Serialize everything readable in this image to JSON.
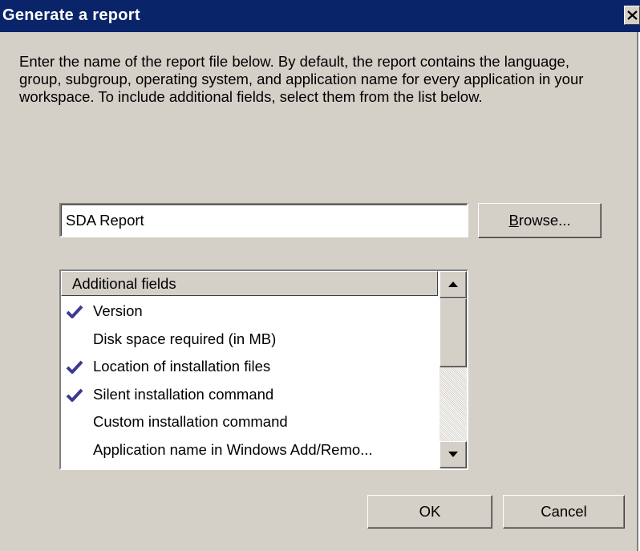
{
  "window": {
    "title": "Generate a report",
    "close_icon": "close-icon"
  },
  "description": "Enter the name of the report file below.  By default, the report contains the language, group, subgroup, operating system, and application name for every application in your workspace.  To include additional fields, select them from the list below.",
  "filename": {
    "value": "SDA Report"
  },
  "browse_button": {
    "label": "Browse..."
  },
  "fields_list": {
    "header": "Additional fields",
    "check_icon": "check-icon",
    "check_color": "#3b3b8f",
    "items": [
      {
        "label": "Version",
        "checked": true
      },
      {
        "label": "Disk space required (in MB)",
        "checked": false
      },
      {
        "label": "Location of installation files",
        "checked": true
      },
      {
        "label": "Silent installation command",
        "checked": true
      },
      {
        "label": "Custom installation command",
        "checked": false
      },
      {
        "label": "Application name in Windows Add/Remo...",
        "checked": false
      }
    ]
  },
  "buttons": {
    "ok_label": "OK",
    "cancel_label": "Cancel"
  },
  "colors": {
    "titlebar": "#0a246a",
    "face": "#d4d0c8"
  }
}
